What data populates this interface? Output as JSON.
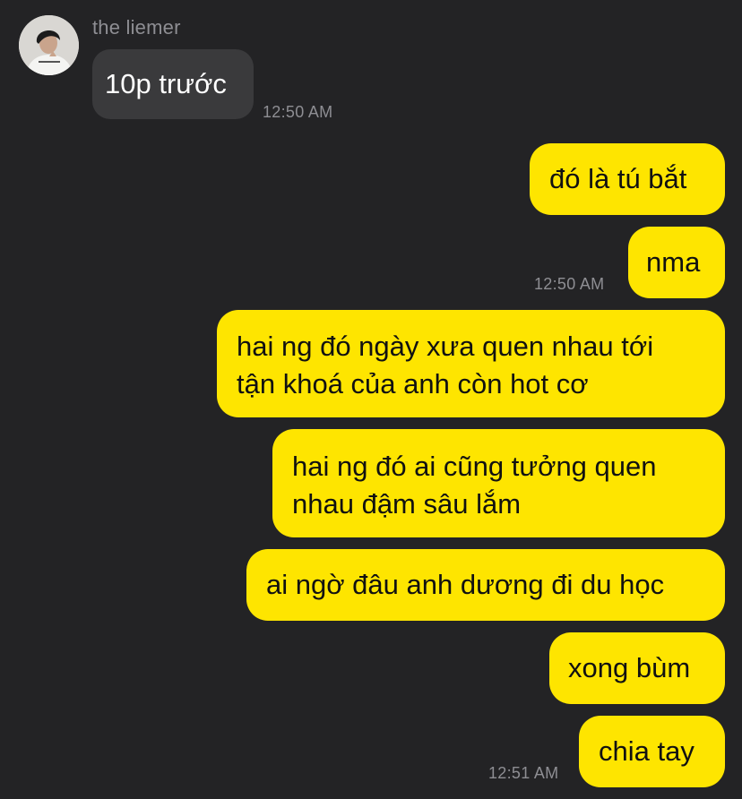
{
  "contact": {
    "name": "the liemer",
    "avatar_icon": "profile-photo-icon"
  },
  "messages": [
    {
      "direction": "incoming",
      "text": "10p trước",
      "time": "12:50 AM"
    },
    {
      "direction": "outgoing",
      "text": "đó là tú bắt"
    },
    {
      "direction": "outgoing",
      "text": "nma",
      "time": "12:50 AM"
    },
    {
      "direction": "outgoing",
      "lines": [
        "hai ng đó ngày xưa quen nhau tới",
        "tận khoá của anh còn hot cơ"
      ]
    },
    {
      "direction": "outgoing",
      "lines": [
        "hai ng đó ai cũng tưởng quen",
        "nhau đậm sâu lắm"
      ]
    },
    {
      "direction": "outgoing",
      "text": "ai ngờ đâu anh dương đi du học"
    },
    {
      "direction": "outgoing",
      "text": "xong bùm"
    },
    {
      "direction": "outgoing",
      "text": "chia tay",
      "time": "12:51 AM"
    }
  ],
  "colors": {
    "background": "#232325",
    "incoming_bubble": "#3a3a3c",
    "outgoing_bubble": "#fee500",
    "timestamp": "#8e8e93"
  }
}
